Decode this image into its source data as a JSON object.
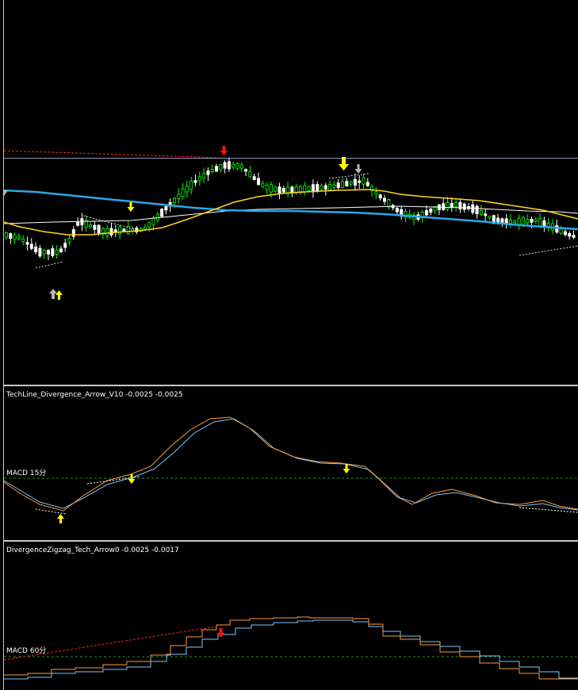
{
  "colors": {
    "background": "#000000",
    "separator": "#c8c8c8",
    "candle_up": "#00ff00",
    "candle_down": "#ffffff",
    "ma_fast": "#ffd21e",
    "ma_slow": "#2aa8e6",
    "ma_white": "#ffffff",
    "macd_main": "#ff9a3c",
    "macd_signal": "#7ec8ff",
    "zero_line": "#1f8f2a",
    "trend_red": "#ff2020",
    "arrow_yellow": "#ffff00",
    "arrow_red": "#ff1010",
    "arrow_gray": "#b4b4b4"
  },
  "main_chart": {
    "symbol_arrows": [
      {
        "name": "down-arrow-icon",
        "color": "red"
      },
      {
        "name": "down-arrow-icon",
        "color": "yellow"
      },
      {
        "name": "down-arrow-icon",
        "color": "gray"
      },
      {
        "name": "down-arrow-icon",
        "color": "yellow"
      },
      {
        "name": "up-arrow-icon",
        "color": "gray"
      },
      {
        "name": "up-arrow-icon",
        "color": "yellow"
      }
    ]
  },
  "indicator1": {
    "title": "TechLine_Divergence_Arrow_V10 -0.0025 -0.0025",
    "label": "MACD  15分"
  },
  "indicator2": {
    "title": "DivergenceZigzag_Tech_Arrow0 -0.0025 -0.0017",
    "label": "MACD  60分"
  }
}
